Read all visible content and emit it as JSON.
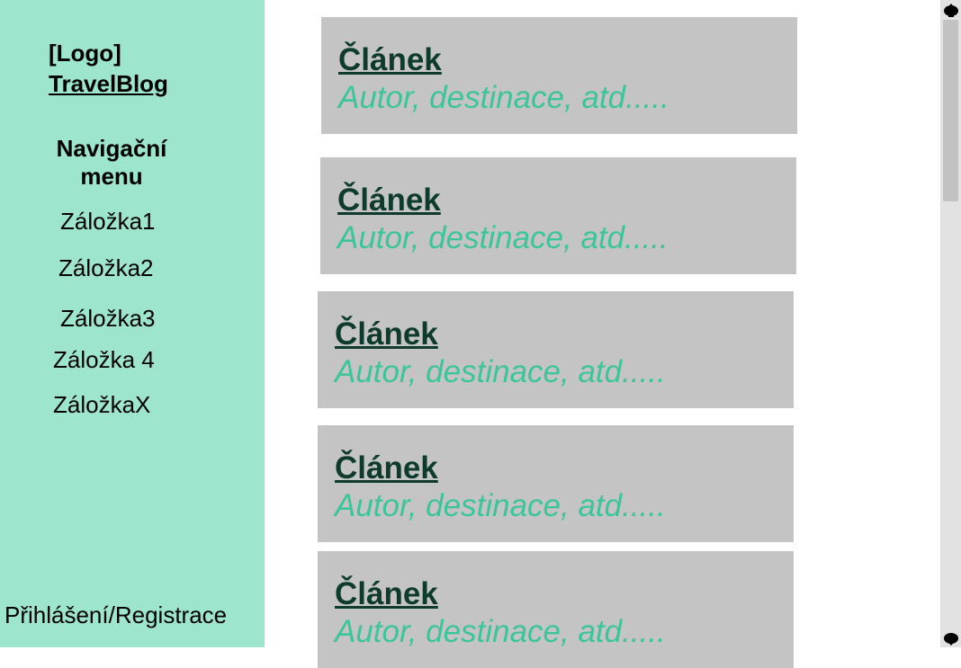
{
  "sidebar": {
    "logo": "[Logo]",
    "brand": "TravelBlog",
    "nav_title": "Navigační menu",
    "items": [
      "Záložka1",
      "Záložka2",
      "Záložka3",
      "Záložka 4",
      "ZáložkaX"
    ],
    "login": "Přihlášení/Registrace"
  },
  "articles": [
    {
      "title": "Článek",
      "meta": "Autor, destinace, atd....."
    },
    {
      "title": "Článek",
      "meta": "Autor, destinace, atd....."
    },
    {
      "title": "Článek",
      "meta": "Autor, destinace, atd....."
    },
    {
      "title": "Článek",
      "meta": "Autor, destinace, atd....."
    },
    {
      "title": "Článek",
      "meta": "Autor, destinace, atd....."
    }
  ],
  "colors": {
    "sidebar_bg": "#9de5cc",
    "card_bg": "#c4c4c4",
    "title_color": "#0e3b2d",
    "meta_color": "#3cc49a"
  },
  "scrollbar": {
    "up_icon": "scroll-up-arrow-icon",
    "down_icon": "scroll-down-arrow-icon"
  }
}
